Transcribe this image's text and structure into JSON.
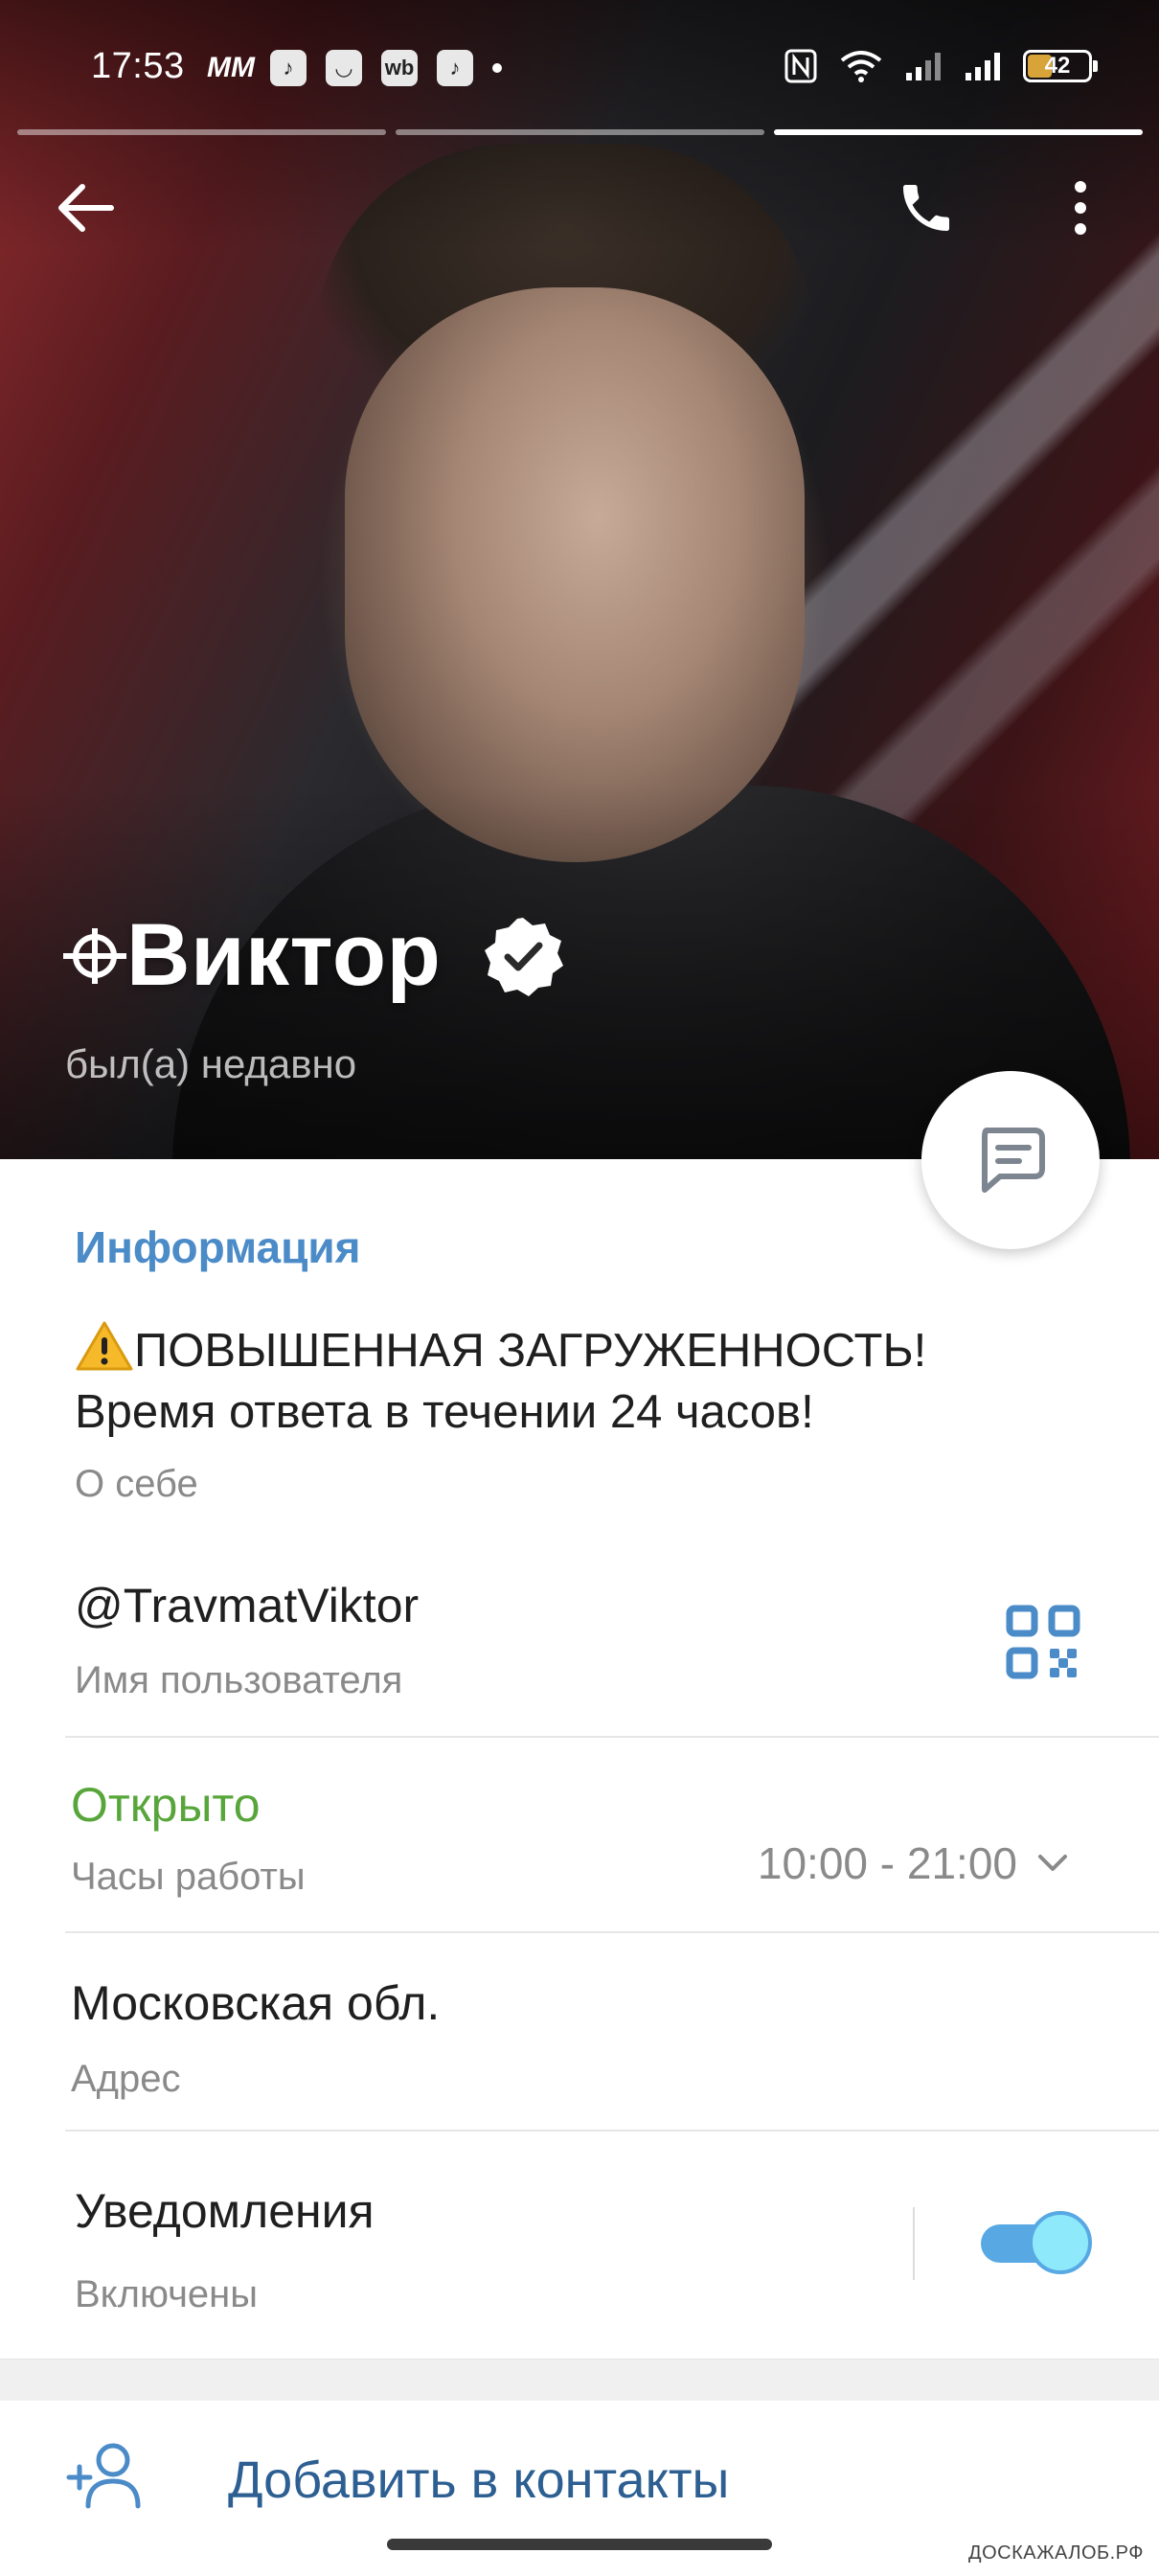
{
  "status_bar": {
    "time": "17:53",
    "apps": [
      {
        "name": "mm-app-icon",
        "label": "MM"
      },
      {
        "name": "music-app-icon",
        "label": "♪"
      },
      {
        "name": "smile-app-icon",
        "label": "◡"
      },
      {
        "name": "wb-app-icon",
        "label": "wb"
      },
      {
        "name": "music-app-2-icon",
        "label": "♪"
      }
    ],
    "battery_level": "42",
    "battery_color": "#d8a43a"
  },
  "story_bars": {
    "count": 3,
    "active_index": 2
  },
  "profile": {
    "name": "Виктор",
    "last_seen": "был(а) недавно",
    "verified": true
  },
  "info": {
    "section_title": "Информация",
    "bio_line1": "ПОВЫШЕННАЯ ЗАГРУЖЕННОСТЬ!",
    "bio_line2": "Время ответа в течении 24 часов!",
    "bio_label": "О себе",
    "username": "@TravmatViktor",
    "username_label": "Имя пользователя",
    "open_status": "Открыто",
    "hours_label": "Часы работы",
    "hours_value": "10:00 - 21:00",
    "address": "Московская обл.",
    "address_label": "Адрес",
    "notifications_title": "Уведомления",
    "notifications_status": "Включены",
    "notifications_enabled": true
  },
  "actions": {
    "add_contact": "Добавить в контакты"
  },
  "colors": {
    "accent": "#4a8bc8",
    "open_green": "#58a63b",
    "link_blue": "#2d5f92",
    "toggle_on": "#57a8e3"
  },
  "watermark": "ДОСКАЖАЛОБ.РФ"
}
